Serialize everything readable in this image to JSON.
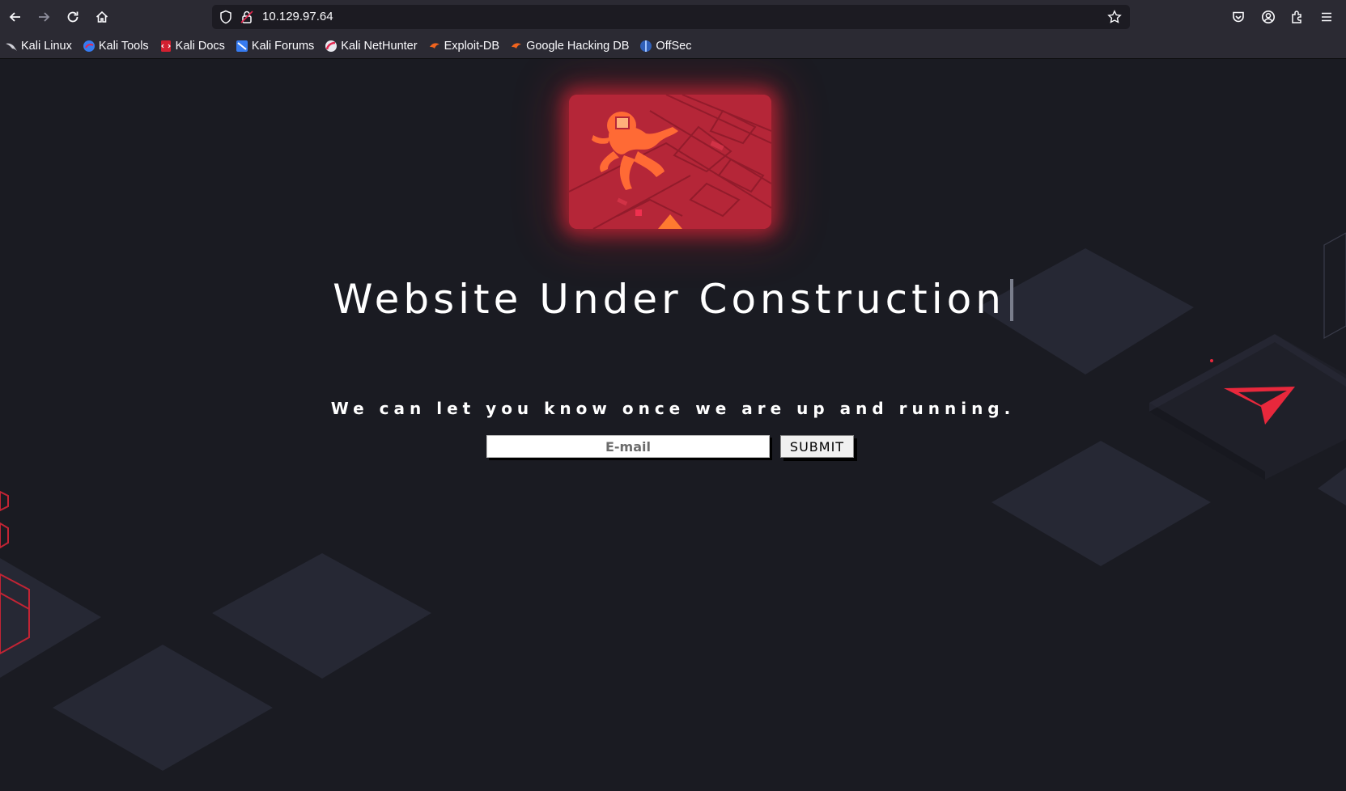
{
  "browser": {
    "url": "10.129.97.64",
    "bookmarks": [
      {
        "label": "Kali Linux",
        "icon": "kali-dragon-icon"
      },
      {
        "label": "Kali Tools",
        "icon": "kali-tools-icon"
      },
      {
        "label": "Kali Docs",
        "icon": "kali-docs-icon"
      },
      {
        "label": "Kali Forums",
        "icon": "kali-forums-icon"
      },
      {
        "label": "Kali NetHunter",
        "icon": "kali-nethunter-icon"
      },
      {
        "label": "Exploit-DB",
        "icon": "exploit-db-icon"
      },
      {
        "label": "Google Hacking DB",
        "icon": "ghdb-icon"
      },
      {
        "label": "OffSec",
        "icon": "offsec-icon"
      }
    ]
  },
  "page": {
    "title": "Website Under Construction",
    "subtitle": "We can let you know once we are up and running.",
    "email_placeholder": "E-mail",
    "submit_label": "SUBMIT"
  },
  "colors": {
    "background": "#1a1b22",
    "accent": "#e8283c",
    "tile": "#262834"
  }
}
